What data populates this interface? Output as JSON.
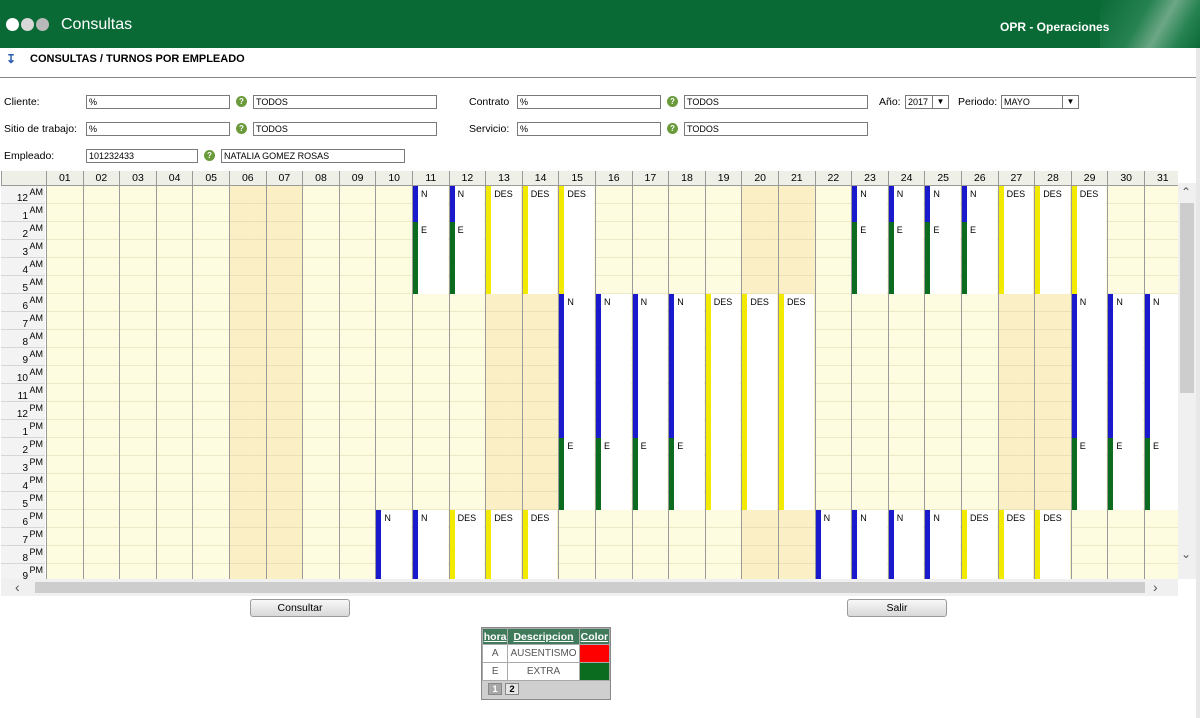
{
  "window": {
    "title": "Consultas",
    "module": "OPR - Operaciones"
  },
  "header": {
    "title": "CONSULTAS / TURNOS POR EMPLEADO"
  },
  "filters": {
    "cliente": {
      "label": "Cliente:",
      "code": "%",
      "name": "TODOS"
    },
    "contrato": {
      "label": "Contrato",
      "code": "%",
      "name": "TODOS"
    },
    "anio": {
      "label": "Año:",
      "value": "2017"
    },
    "periodo": {
      "label": "Periodo:",
      "value": "MAYO"
    },
    "sitio": {
      "label": "Sitio de trabajo:",
      "code": "%",
      "name": "TODOS"
    },
    "servicio": {
      "label": "Servicio:",
      "code": "%",
      "name": "TODOS"
    },
    "empleado": {
      "label": "Empleado:",
      "code": "101232433",
      "name": "NATALIA GOMEZ ROSAS"
    }
  },
  "grid": {
    "days": [
      "01",
      "02",
      "03",
      "04",
      "05",
      "06",
      "07",
      "08",
      "09",
      "10",
      "11",
      "12",
      "13",
      "14",
      "15",
      "16",
      "17",
      "18",
      "19",
      "20",
      "21",
      "22",
      "23",
      "24",
      "25",
      "26",
      "27",
      "28",
      "29",
      "30",
      "31"
    ],
    "weekend_days": [
      "06",
      "07",
      "13",
      "14",
      "20",
      "21",
      "27",
      "28"
    ],
    "hours": [
      {
        "num": "12",
        "mer": "AM"
      },
      {
        "num": "1",
        "mer": "AM"
      },
      {
        "num": "2",
        "mer": "AM"
      },
      {
        "num": "3",
        "mer": "AM"
      },
      {
        "num": "4",
        "mer": "AM"
      },
      {
        "num": "5",
        "mer": "AM"
      },
      {
        "num": "6",
        "mer": "AM"
      },
      {
        "num": "7",
        "mer": "AM"
      },
      {
        "num": "8",
        "mer": "AM"
      },
      {
        "num": "9",
        "mer": "AM"
      },
      {
        "num": "10",
        "mer": "AM"
      },
      {
        "num": "11",
        "mer": "AM"
      },
      {
        "num": "12",
        "mer": "PM"
      },
      {
        "num": "1",
        "mer": "PM"
      },
      {
        "num": "2",
        "mer": "PM"
      },
      {
        "num": "3",
        "mer": "PM"
      },
      {
        "num": "4",
        "mer": "PM"
      },
      {
        "num": "5",
        "mer": "PM"
      },
      {
        "num": "6",
        "mer": "PM"
      },
      {
        "num": "7",
        "mer": "PM"
      },
      {
        "num": "8",
        "mer": "PM"
      },
      {
        "num": "9",
        "mer": "PM"
      }
    ],
    "colors": {
      "N": "#1a1acc",
      "E": "#0b6b1f",
      "DES": "#f2ea00"
    },
    "shifts": [
      {
        "day": "11",
        "code": "N",
        "start": 0,
        "end": 2
      },
      {
        "day": "11",
        "code": "E",
        "start": 2,
        "end": 6
      },
      {
        "day": "12",
        "code": "N",
        "start": 0,
        "end": 2
      },
      {
        "day": "12",
        "code": "E",
        "start": 2,
        "end": 6
      },
      {
        "day": "13",
        "code": "DES",
        "start": 0,
        "end": 6
      },
      {
        "day": "14",
        "code": "DES",
        "start": 0,
        "end": 6
      },
      {
        "day": "15",
        "code": "DES",
        "start": 0,
        "end": 6
      },
      {
        "day": "23",
        "code": "N",
        "start": 0,
        "end": 2
      },
      {
        "day": "23",
        "code": "E",
        "start": 2,
        "end": 6
      },
      {
        "day": "24",
        "code": "N",
        "start": 0,
        "end": 2
      },
      {
        "day": "24",
        "code": "E",
        "start": 2,
        "end": 6
      },
      {
        "day": "25",
        "code": "N",
        "start": 0,
        "end": 2
      },
      {
        "day": "25",
        "code": "E",
        "start": 2,
        "end": 6
      },
      {
        "day": "26",
        "code": "N",
        "start": 0,
        "end": 2
      },
      {
        "day": "26",
        "code": "E",
        "start": 2,
        "end": 6
      },
      {
        "day": "27",
        "code": "DES",
        "start": 0,
        "end": 6
      },
      {
        "day": "28",
        "code": "DES",
        "start": 0,
        "end": 6
      },
      {
        "day": "29",
        "code": "DES",
        "start": 0,
        "end": 6
      },
      {
        "day": "15",
        "code": "N",
        "start": 6,
        "end": 14
      },
      {
        "day": "15",
        "code": "E",
        "start": 14,
        "end": 18
      },
      {
        "day": "16",
        "code": "N",
        "start": 6,
        "end": 14
      },
      {
        "day": "16",
        "code": "E",
        "start": 14,
        "end": 18
      },
      {
        "day": "17",
        "code": "N",
        "start": 6,
        "end": 14
      },
      {
        "day": "17",
        "code": "E",
        "start": 14,
        "end": 18
      },
      {
        "day": "18",
        "code": "N",
        "start": 6,
        "end": 14
      },
      {
        "day": "18",
        "code": "E",
        "start": 14,
        "end": 18
      },
      {
        "day": "19",
        "code": "DES",
        "start": 6,
        "end": 18
      },
      {
        "day": "20",
        "code": "DES",
        "start": 6,
        "end": 18
      },
      {
        "day": "21",
        "code": "DES",
        "start": 6,
        "end": 18
      },
      {
        "day": "29",
        "code": "N",
        "start": 6,
        "end": 14
      },
      {
        "day": "29",
        "code": "E",
        "start": 14,
        "end": 18
      },
      {
        "day": "30",
        "code": "N",
        "start": 6,
        "end": 14
      },
      {
        "day": "30",
        "code": "E",
        "start": 14,
        "end": 18
      },
      {
        "day": "31",
        "code": "N",
        "start": 6,
        "end": 14
      },
      {
        "day": "31",
        "code": "E",
        "start": 14,
        "end": 18
      },
      {
        "day": "10",
        "code": "N",
        "start": 18,
        "end": 22
      },
      {
        "day": "11",
        "code": "N",
        "start": 18,
        "end": 22
      },
      {
        "day": "12",
        "code": "DES",
        "start": 18,
        "end": 22
      },
      {
        "day": "13",
        "code": "DES",
        "start": 18,
        "end": 22
      },
      {
        "day": "14",
        "code": "DES",
        "start": 18,
        "end": 22
      },
      {
        "day": "22",
        "code": "N",
        "start": 18,
        "end": 22
      },
      {
        "day": "23",
        "code": "N",
        "start": 18,
        "end": 22
      },
      {
        "day": "24",
        "code": "N",
        "start": 18,
        "end": 22
      },
      {
        "day": "25",
        "code": "N",
        "start": 18,
        "end": 22
      },
      {
        "day": "26",
        "code": "DES",
        "start": 18,
        "end": 22
      },
      {
        "day": "27",
        "code": "DES",
        "start": 18,
        "end": 22
      },
      {
        "day": "28",
        "code": "DES",
        "start": 18,
        "end": 22
      }
    ]
  },
  "buttons": {
    "consultar": "Consultar",
    "salir": "Salir"
  },
  "legend": {
    "headers": {
      "hora": "hora",
      "descripcion": "Descripcion",
      "color": "Color"
    },
    "rows": [
      {
        "hora": "A",
        "descripcion": "AUSENTISMO",
        "color": "#ff0000"
      },
      {
        "hora": "E",
        "descripcion": "EXTRA",
        "color": "#0b6b1f"
      }
    ],
    "pages": [
      "1",
      "2"
    ]
  },
  "icons": {
    "help": "help-icon",
    "info": "info-icon"
  }
}
